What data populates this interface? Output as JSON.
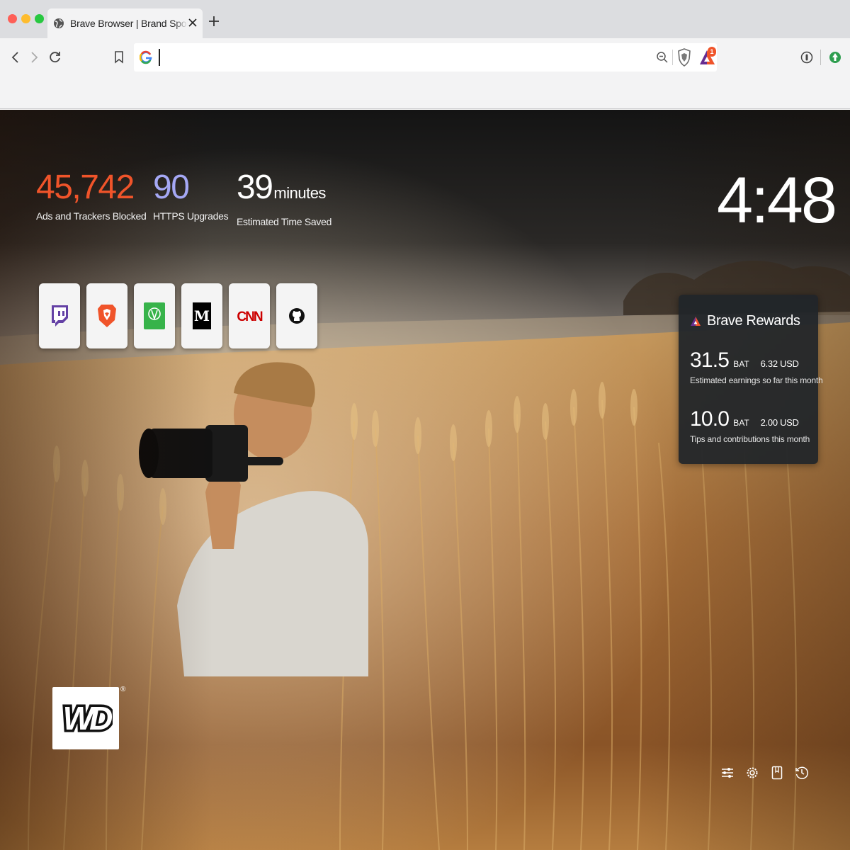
{
  "window": {
    "traffic_lights": [
      "close",
      "minimize",
      "zoom"
    ]
  },
  "tab": {
    "title": "Brave Browser | Brand Sponsorship",
    "favicon": "globe-icon",
    "close_label": "X",
    "new_tab_label": "+"
  },
  "toolbar": {
    "back": "chevron-left-icon",
    "forward": "chevron-right-icon",
    "reload": "reload-icon",
    "bookmark": "bookmark-icon",
    "search_engine": "google-g-icon",
    "url_value": "",
    "zoom": "zoom-out-icon",
    "shields": "brave-shields-icon",
    "rewards": "bat-triangle-icon",
    "rewards_badge": "1",
    "extension_1": "password-manager-icon",
    "extension_2": "green-extension-icon"
  },
  "stats": {
    "trackers": {
      "value": "45,742",
      "label": "Ads and Trackers Blocked",
      "color": "#f0542a"
    },
    "https": {
      "value": "90",
      "label": "HTTPS Upgrades",
      "color": "#a5a8f5"
    },
    "time": {
      "value": "39",
      "unit": "minutes",
      "label": "Estimated Time Saved",
      "color": "#ffffff"
    }
  },
  "clock": {
    "time": "4:48"
  },
  "top_sites": [
    {
      "name": "twitch",
      "icon": "twitch-icon",
      "color": "#6441a5"
    },
    {
      "name": "brave",
      "icon": "brave-lion-icon",
      "color": "#f0542a"
    },
    {
      "name": "upwork",
      "icon": "upwork-icon",
      "color": "#37b34a"
    },
    {
      "name": "medium",
      "icon": "medium-icon",
      "color": "#000000"
    },
    {
      "name": "cnn",
      "icon": "cnn-icon",
      "color": "#cc0000",
      "text": "CNN"
    },
    {
      "name": "github",
      "icon": "github-icon",
      "color": "#111111"
    }
  ],
  "rewards": {
    "title": "Brave Rewards",
    "earnings": {
      "bat": "31.5",
      "bat_unit": "BAT",
      "usd": "6.32 USD",
      "desc": "Estimated earnings so far this month"
    },
    "tips": {
      "bat": "10.0",
      "bat_unit": "BAT",
      "usd": "2.00 USD",
      "desc": "Tips and contributions this month"
    }
  },
  "sponsor": {
    "logo_text": "WD",
    "registered": "®",
    "icon": "western-digital-logo"
  },
  "footer": [
    {
      "name": "customize-icon"
    },
    {
      "name": "settings-icon"
    },
    {
      "name": "bookmarks-icon"
    },
    {
      "name": "history-icon"
    }
  ]
}
